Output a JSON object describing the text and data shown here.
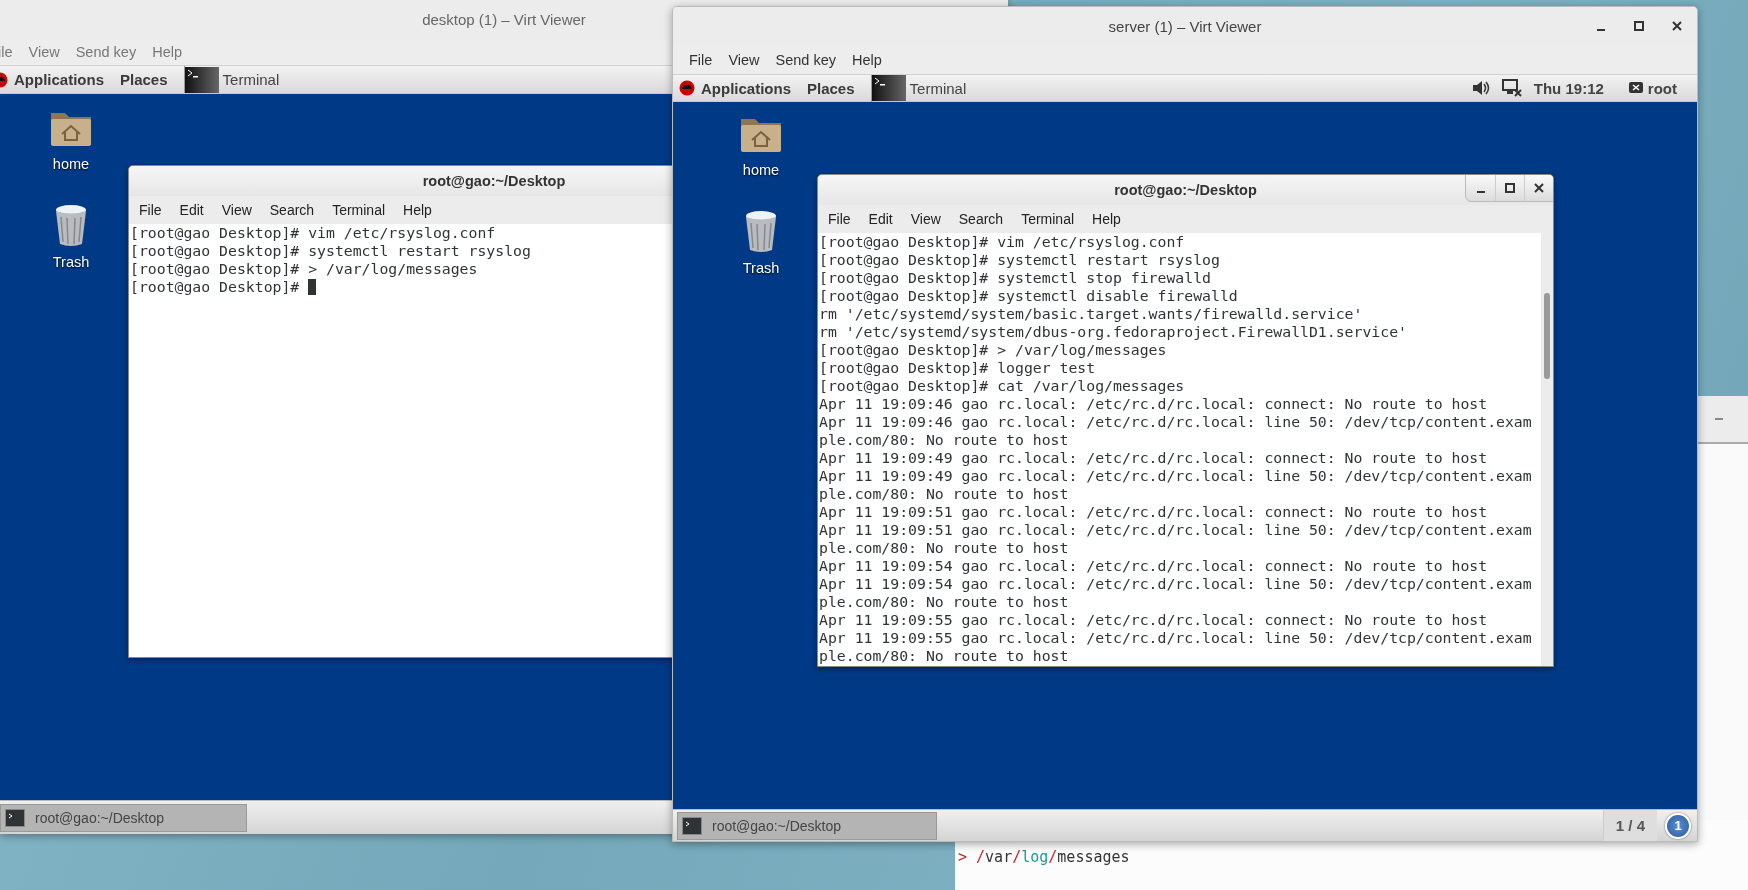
{
  "viewers": [
    {
      "title": "desktop (1) – Virt Viewer",
      "menu": [
        "ile",
        "View",
        "Send key",
        "Help"
      ],
      "panel": {
        "menus": [
          "Applications",
          "Places"
        ],
        "task": "Terminal"
      },
      "icons": [
        {
          "kind": "folder",
          "label": "home"
        },
        {
          "kind": "trash",
          "label": "Trash"
        }
      ],
      "terminal": {
        "title": "root@gao:~/Desktop",
        "menu": [
          "File",
          "Edit",
          "View",
          "Search",
          "Terminal",
          "Help"
        ],
        "lines": [
          "[root@gao Desktop]# vim /etc/rsyslog.conf",
          "[root@gao Desktop]# systemctl restart rsyslog",
          "[root@gao Desktop]# > /var/log/messages",
          "[root@gao Desktop]# "
        ],
        "cursor": true
      },
      "taskbar": {
        "task": "root@gao:~/Desktop"
      }
    },
    {
      "title": "server (1) – Virt Viewer",
      "menu": [
        "File",
        "View",
        "Send key",
        "Help"
      ],
      "panel": {
        "menus": [
          "Applications",
          "Places"
        ],
        "task": "Terminal",
        "clock": "Thu 19:12",
        "user": "root"
      },
      "icons": [
        {
          "kind": "folder",
          "label": "home"
        },
        {
          "kind": "trash",
          "label": "Trash"
        }
      ],
      "terminal": {
        "title": "root@gao:~/Desktop",
        "menu": [
          "File",
          "Edit",
          "View",
          "Search",
          "Terminal",
          "Help"
        ],
        "lines": [
          "[root@gao Desktop]# vim /etc/rsyslog.conf",
          "[root@gao Desktop]# systemctl restart rsyslog",
          "[root@gao Desktop]# systemctl stop firewalld",
          "[root@gao Desktop]# systemctl disable firewalld",
          "rm '/etc/systemd/system/basic.target.wants/firewalld.service'",
          "rm '/etc/systemd/system/dbus-org.fedoraproject.FirewallD1.service'",
          "[root@gao Desktop]# > /var/log/messages",
          "[root@gao Desktop]# logger test",
          "[root@gao Desktop]# cat /var/log/messages",
          "Apr 11 19:09:46 gao rc.local: /etc/rc.d/rc.local: connect: No route to host",
          "Apr 11 19:09:46 gao rc.local: /etc/rc.d/rc.local: line 50: /dev/tcp/content.exam",
          "ple.com/80: No route to host",
          "Apr 11 19:09:49 gao rc.local: /etc/rc.d/rc.local: connect: No route to host",
          "Apr 11 19:09:49 gao rc.local: /etc/rc.d/rc.local: line 50: /dev/tcp/content.exam",
          "ple.com/80: No route to host",
          "Apr 11 19:09:51 gao rc.local: /etc/rc.d/rc.local: connect: No route to host",
          "Apr 11 19:09:51 gao rc.local: /etc/rc.d/rc.local: line 50: /dev/tcp/content.exam",
          "ple.com/80: No route to host",
          "Apr 11 19:09:54 gao rc.local: /etc/rc.d/rc.local: connect: No route to host",
          "Apr 11 19:09:54 gao rc.local: /etc/rc.d/rc.local: line 50: /dev/tcp/content.exam",
          "ple.com/80: No route to host",
          "Apr 11 19:09:55 gao rc.local: /etc/rc.d/rc.local: connect: No route to host",
          "Apr 11 19:09:55 gao rc.local: /etc/rc.d/rc.local: line 50: /dev/tcp/content.exam",
          "ple.com/80: No route to host"
        ]
      },
      "taskbar": {
        "task": "root@gao:~/Desktop",
        "workspace": "1 / 4",
        "badge": "1"
      }
    }
  ],
  "editor": {
    "line": [
      {
        "text": "> /",
        "color": "#c0282d"
      },
      {
        "text": "var",
        "color": "#333333"
      },
      {
        "text": "/",
        "color": "#c0282d"
      },
      {
        "text": "log",
        "color": "#1a9a9a"
      },
      {
        "text": "/",
        "color": "#c0282d"
      },
      {
        "text": "messages",
        "color": "#333333"
      }
    ]
  }
}
